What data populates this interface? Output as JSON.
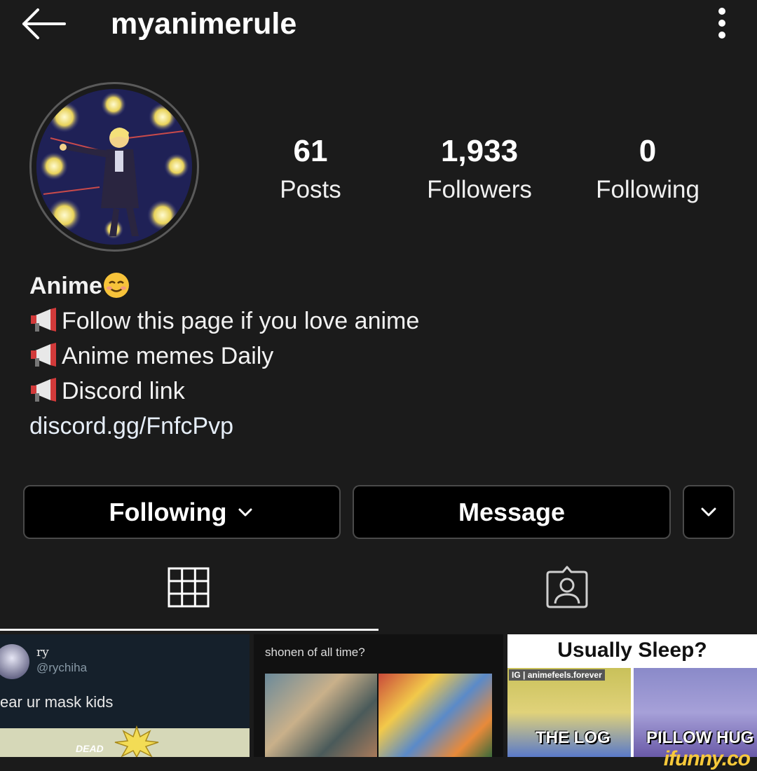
{
  "header": {
    "username": "myanimerule",
    "back_icon": "arrow-left-icon",
    "more_icon": "more-vertical-icon"
  },
  "profile": {
    "stats": [
      {
        "value": "61",
        "label": "Posts"
      },
      {
        "value": "1,933",
        "label": "Followers"
      },
      {
        "value": "0",
        "label": "Following"
      }
    ],
    "bio": {
      "name": "Anime",
      "lines": [
        "Follow this page if you love anime",
        "Anime memes Daily",
        "Discord link"
      ],
      "link": "discord.gg/FnfcPvp"
    }
  },
  "actions": {
    "following_label": "Following",
    "message_label": "Message"
  },
  "tabs": {
    "grid_icon": "grid-icon",
    "tagged_icon": "tagged-person-icon"
  },
  "posts": {
    "p1": {
      "handle_name": "ry",
      "handle": "@rychiha",
      "text": "ear ur mask kids",
      "badge": "DEAD"
    },
    "p2": {
      "text": "shonen of all time?"
    },
    "p3": {
      "title": "Usually Sleep?",
      "tag": "IG | animefeels.forever",
      "left_caption": "THE LOG",
      "right_caption": "PILLOW HUG"
    }
  },
  "watermark": "ifunny.co",
  "colors": {
    "background": "#1b1b1b",
    "button_bg": "#000000",
    "button_border": "#4a4a4a",
    "watermark": "#f8c93a"
  }
}
